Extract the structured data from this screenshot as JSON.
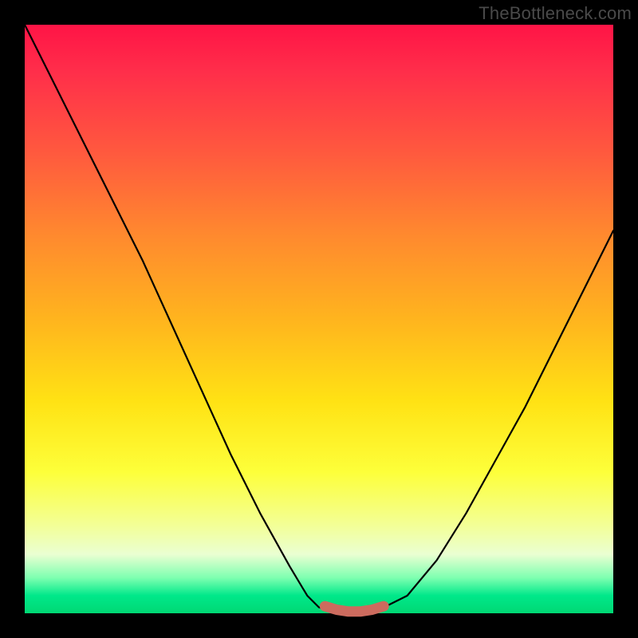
{
  "watermark": "TheBottleneck.com",
  "chart_data": {
    "type": "line",
    "title": "",
    "xlabel": "",
    "ylabel": "",
    "xlim": [
      0,
      100
    ],
    "ylim": [
      0,
      100
    ],
    "grid": false,
    "legend": false,
    "series": [
      {
        "name": "bottleneck-curve",
        "x": [
          0,
          5,
          10,
          15,
          20,
          25,
          30,
          35,
          40,
          45,
          48,
          50,
          52,
          54,
          56,
          58,
          60,
          65,
          70,
          75,
          80,
          85,
          90,
          95,
          100
        ],
        "values": [
          100,
          90,
          80,
          70,
          60,
          49,
          38,
          27,
          17,
          8,
          3,
          1,
          0.5,
          0,
          0,
          0,
          0.5,
          3,
          9,
          17,
          26,
          35,
          45,
          55,
          65
        ]
      },
      {
        "name": "optimal-band",
        "x": [
          51,
          53,
          55,
          57,
          59,
          61
        ],
        "values": [
          1.2,
          0.6,
          0.3,
          0.3,
          0.6,
          1.2
        ]
      }
    ],
    "colors": {
      "bottleneck-curve": "#000000",
      "optimal-band": "#cc6b5e"
    },
    "background_gradient": {
      "top": "#ff1446",
      "mid": "#ffe214",
      "bottom": "#00d874"
    }
  }
}
